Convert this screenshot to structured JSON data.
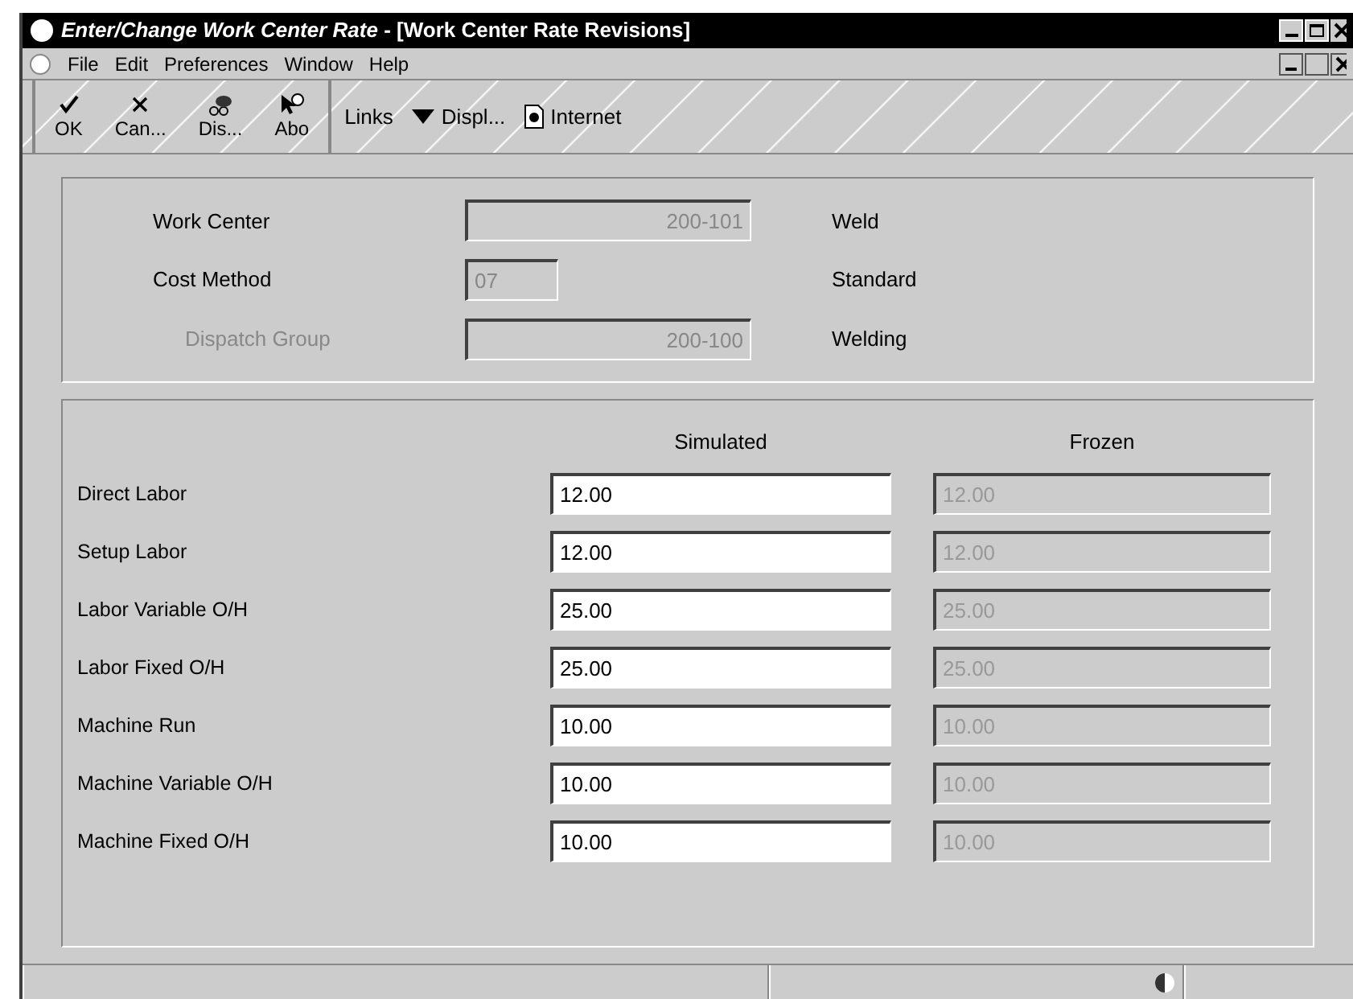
{
  "window": {
    "title": "*Enter/Change Work Center Rate*  - [Work Center Rate Revisions]"
  },
  "menu": [
    "File",
    "Edit",
    "Preferences",
    "Window",
    "Help"
  ],
  "toolbar": [
    {
      "kind": "check",
      "label": "OK"
    },
    {
      "kind": "cross",
      "label": "Can..."
    },
    {
      "kind": "binoculars",
      "label": "Dis..."
    },
    {
      "kind": "help",
      "label": "Abo"
    }
  ],
  "links": [
    {
      "kind": "plain",
      "label": "Links"
    },
    {
      "kind": "dropdown",
      "label": "Displ..."
    },
    {
      "kind": "page",
      "label": "Internet"
    }
  ],
  "header": [
    {
      "label": "Work Center",
      "value": "200-101",
      "description": "Weld",
      "kind": "wide",
      "disabled": false
    },
    {
      "label": "Cost Method",
      "value": "07",
      "description": "Standard",
      "kind": "short",
      "disabled": false
    },
    {
      "label": "Dispatch Group",
      "value": "200-100",
      "description": "Welding",
      "kind": "wide",
      "disabled": true
    }
  ],
  "rates": {
    "columns": [
      "Simulated",
      "Frozen"
    ],
    "rows": [
      {
        "label": "Direct Labor",
        "simulated": "12.00",
        "frozen": "12.00"
      },
      {
        "label": "Setup Labor",
        "simulated": "12.00",
        "frozen": "12.00"
      },
      {
        "label": "Labor Variable O/H",
        "simulated": "25.00",
        "frozen": "25.00"
      },
      {
        "label": "Labor Fixed O/H",
        "simulated": "25.00",
        "frozen": "25.00"
      },
      {
        "label": "Machine Run",
        "simulated": "10.00",
        "frozen": "10.00"
      },
      {
        "label": "Machine Variable O/H",
        "simulated": "10.00",
        "frozen": "10.00"
      },
      {
        "label": "Machine Fixed O/H",
        "simulated": "10.00",
        "frozen": "10.00"
      }
    ]
  }
}
